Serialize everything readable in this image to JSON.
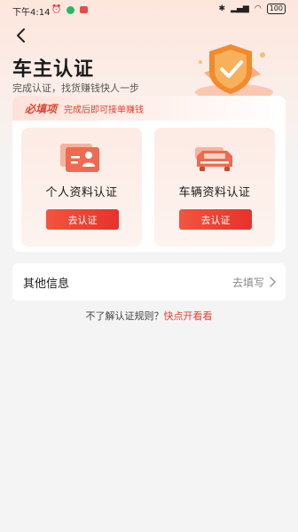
{
  "status_bar": {
    "time": "下午4:14",
    "battery": "100"
  },
  "header": {
    "title": "车主认证",
    "subtitle": "完成认证，找货赚钱快人一步"
  },
  "required_section": {
    "tag": "必填项",
    "note": "完成后即可接单赚钱",
    "items": [
      {
        "label": "个人资料认证",
        "button": "去认证",
        "icon": "id-card-icon"
      },
      {
        "label": "车辆资料认证",
        "button": "去认证",
        "icon": "truck-icon"
      }
    ]
  },
  "other_info": {
    "title": "其他信息",
    "action": "去填写"
  },
  "rules": {
    "prompt": "不了解认证规则？",
    "link": "快点开看看"
  },
  "colors": {
    "accent": "#e2432f",
    "button": "#ec3e2d",
    "background": "#f4f4f4"
  }
}
